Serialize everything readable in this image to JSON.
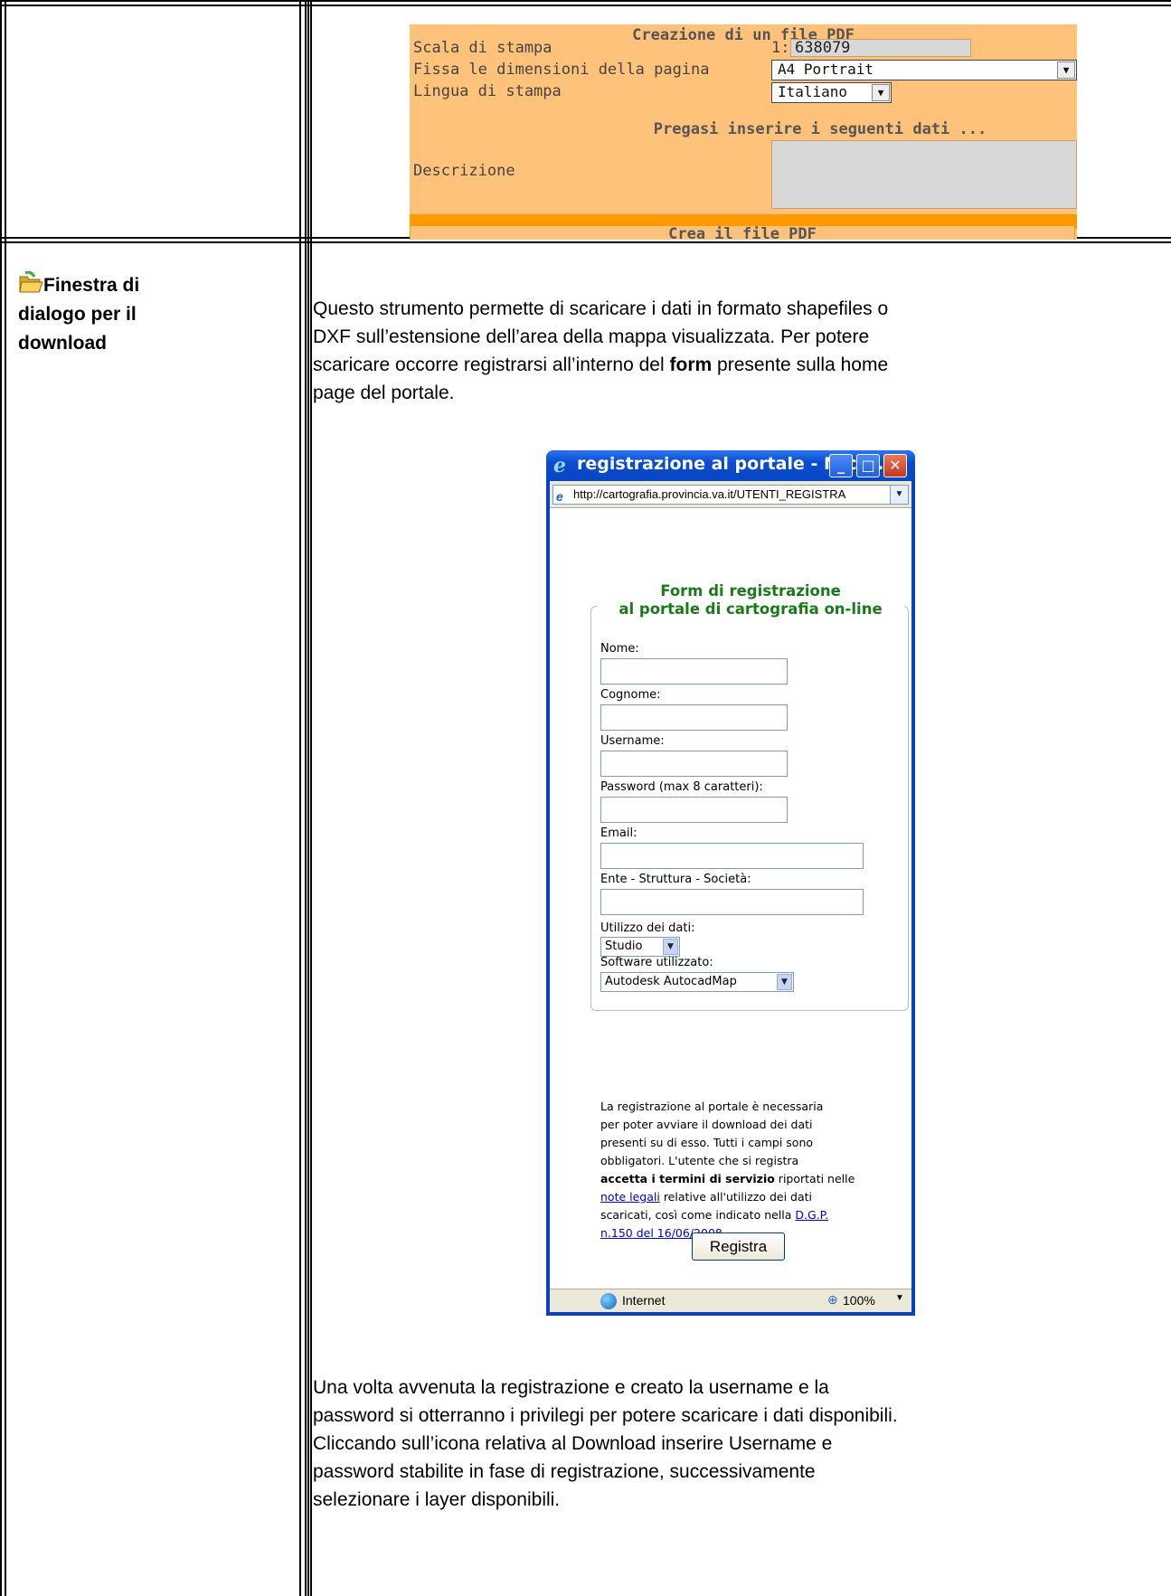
{
  "pdf_panel": {
    "title": "Creazione di un file PDF",
    "scale_label": "Scala di stampa",
    "scale_prefix": "1:",
    "scale_value": "638079",
    "page_size_label": "Fissa le dimensioni della pagina",
    "page_size_value": "A4 Portrait",
    "language_label": "Lingua di stampa",
    "language_value": "Italiano",
    "prompt": "Pregasi inserire i seguenti dati ...",
    "description_label": "Descrizione",
    "create_button": "Crea il file PDF"
  },
  "row_label": {
    "icon": "folder-open-icon",
    "line1": "Finestra di",
    "line2": "dialogo per il",
    "line3": "download"
  },
  "intro": {
    "line1": "Questo strumento permette di scaricare i dati in formato shapefiles o",
    "line2": "DXF sull’estensione dell’area della mappa visualizzata. Per potere",
    "line3_pre": "scaricare occorre registrarsi all’interno del",
    "line3_bold": "form",
    "line3_post": "presente sulla home",
    "line4": "page del portale."
  },
  "browser": {
    "title": "registrazione al portale - Micro...",
    "minimize": "_",
    "maximize": "□",
    "close": "✕",
    "address": "http://cartografia.provincia.va.it/UTENTI_REGISTRA",
    "legend_line1": "Form di registrazione",
    "legend_line2": "al portale di cartografia on-line",
    "fields": {
      "nome": "Nome:",
      "cognome": "Cognome:",
      "username": "Username:",
      "password": "Password (max 8 caratteri):",
      "email": "Email:",
      "ente": "Ente - Struttura - Società:",
      "utilizzo": "Utilizzo dei dati:",
      "utilizzo_value": "Studio",
      "software": "Software utilizzato:",
      "software_value": "Autodesk AutocadMap"
    },
    "notice": {
      "l1": "La registrazione al portale è necessaria",
      "l2": "per poter avviare il download dei dati",
      "l3": "presenti su di esso. Tutti i campi sono",
      "l4": "obbligatori. L'utente che si registra",
      "l5_bold": "accetta i termini di servizio",
      "l5_post": " riportati nelle",
      "l6_link": "note legali",
      "l6_post": " relative all'utilizzo dei dati",
      "l7_pre": "scaricati, così come indicato nella ",
      "l7_link": "D.G.P.",
      "l8_link": "n.150 del 16/06/2008",
      "l8_post": "."
    },
    "register_button": "Registra",
    "status_zone": "Internet",
    "status_zoom": "100%"
  },
  "outro": {
    "line1": "Una volta avvenuta la registrazione e creato la username e la",
    "line2": "password si otterranno i privilegi per potere scaricare i dati disponibili.",
    "line3": "Cliccando sull’icona relativa al Download inserire Username e",
    "line4": "password stabilite in fase di registrazione, successivamente",
    "line5": "selezionare i layer disponibili."
  }
}
